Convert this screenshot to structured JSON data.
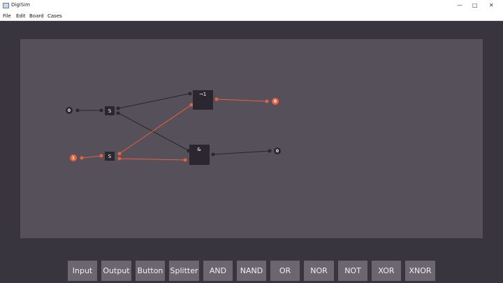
{
  "window": {
    "title": "DigiSim",
    "min_glyph": "—",
    "max_glyph": "□",
    "close_glyph": "✕"
  },
  "menu": [
    {
      "label": "File"
    },
    {
      "label": "Edit"
    },
    {
      "label": "Board"
    },
    {
      "label": "Cases"
    }
  ],
  "circuit": {
    "inputs": [
      {
        "label": "0",
        "state": "off"
      },
      {
        "label": "1",
        "state": "on"
      }
    ],
    "splitters": [
      {
        "label": "S"
      },
      {
        "label": "S"
      }
    ],
    "gates": [
      {
        "label": "¬1",
        "type": "NOT"
      },
      {
        "label": "&",
        "type": "AND"
      }
    ],
    "outputs": [
      {
        "label": "0",
        "state": "on"
      },
      {
        "label": "0",
        "state": "off"
      }
    ],
    "colors": {
      "wire_off": "#29262c",
      "wire_on": "#e8613f",
      "component": "#2b2730",
      "canvas": "#55505a"
    }
  },
  "toolbar": [
    {
      "label": "Input"
    },
    {
      "label": "Output"
    },
    {
      "label": "Button"
    },
    {
      "label": "Splitter"
    },
    {
      "label": "AND"
    },
    {
      "label": "NAND"
    },
    {
      "label": "OR"
    },
    {
      "label": "NOR"
    },
    {
      "label": "NOT"
    },
    {
      "label": "XOR"
    },
    {
      "label": "XNOR"
    }
  ]
}
